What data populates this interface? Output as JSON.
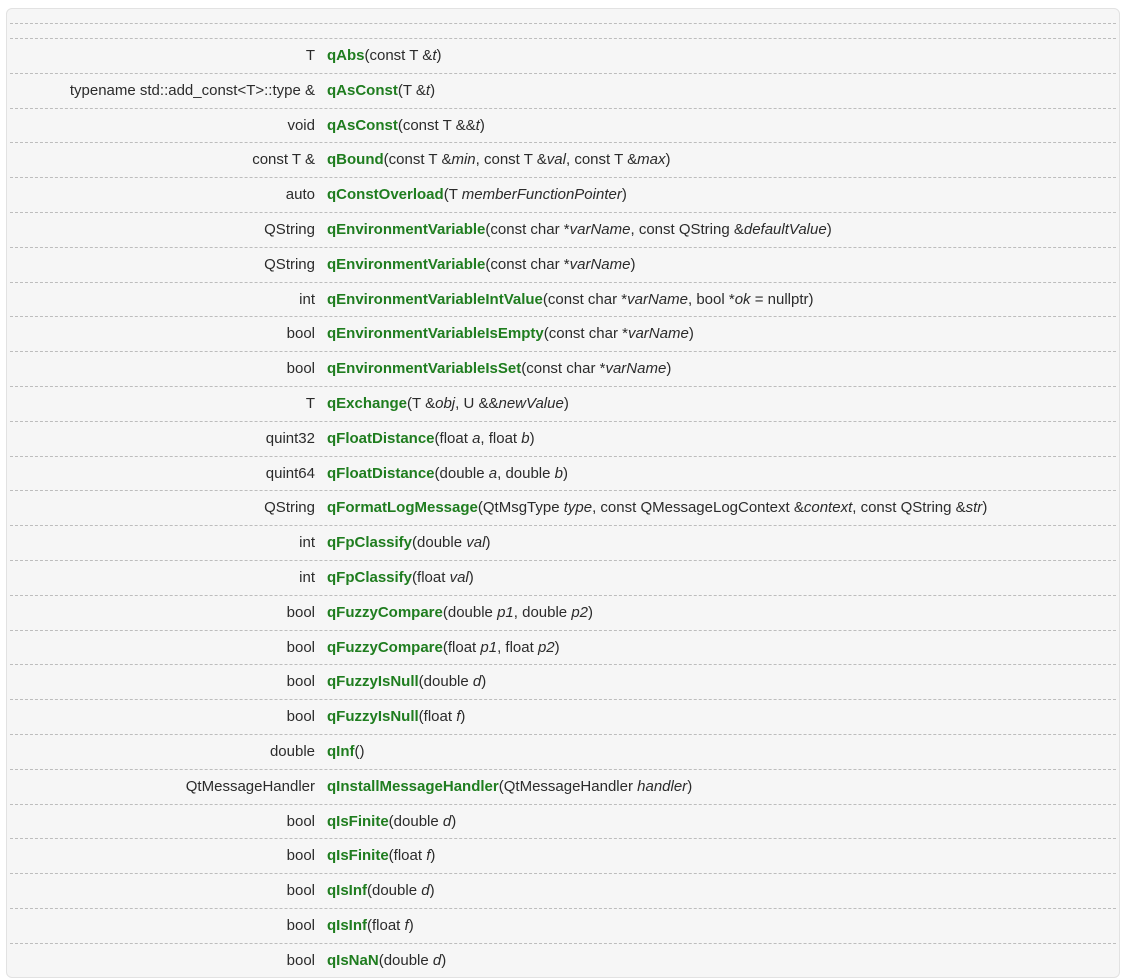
{
  "functions": [
    {
      "ret": "T",
      "name": "qAbs",
      "args": [
        [
          "const T &",
          "t"
        ]
      ]
    },
    {
      "ret": "typename std::add_const<T>::type &",
      "name": "qAsConst",
      "args": [
        [
          "T &",
          "t"
        ]
      ]
    },
    {
      "ret": "void",
      "name": "qAsConst",
      "args": [
        [
          "const T &&",
          "t"
        ]
      ]
    },
    {
      "ret": "const T &",
      "name": "qBound",
      "args": [
        [
          "const T &",
          "min"
        ],
        [
          "const T &",
          "val"
        ],
        [
          "const T &",
          "max"
        ]
      ]
    },
    {
      "ret": "auto",
      "name": "qConstOverload",
      "args": [
        [
          "T ",
          "memberFunctionPointer"
        ]
      ]
    },
    {
      "ret": "QString",
      "name": "qEnvironmentVariable",
      "args": [
        [
          "const char *",
          "varName"
        ],
        [
          "const QString &",
          "defaultValue"
        ]
      ]
    },
    {
      "ret": "QString",
      "name": "qEnvironmentVariable",
      "args": [
        [
          "const char *",
          "varName"
        ]
      ]
    },
    {
      "ret": "int",
      "name": "qEnvironmentVariableIntValue",
      "args": [
        [
          "const char *",
          "varName"
        ],
        [
          "bool *",
          "ok",
          " = nullptr"
        ]
      ]
    },
    {
      "ret": "bool",
      "name": "qEnvironmentVariableIsEmpty",
      "args": [
        [
          "const char *",
          "varName"
        ]
      ]
    },
    {
      "ret": "bool",
      "name": "qEnvironmentVariableIsSet",
      "args": [
        [
          "const char *",
          "varName"
        ]
      ]
    },
    {
      "ret": "T",
      "name": "qExchange",
      "args": [
        [
          "T &",
          "obj"
        ],
        [
          "U &&",
          "newValue"
        ]
      ]
    },
    {
      "ret": "quint32",
      "name": "qFloatDistance",
      "args": [
        [
          "float ",
          "a"
        ],
        [
          "float ",
          "b"
        ]
      ]
    },
    {
      "ret": "quint64",
      "name": "qFloatDistance",
      "args": [
        [
          "double ",
          "a"
        ],
        [
          "double ",
          "b"
        ]
      ]
    },
    {
      "ret": "QString",
      "name": "qFormatLogMessage",
      "args": [
        [
          "QtMsgType ",
          "type"
        ],
        [
          "const QMessageLogContext &",
          "context"
        ],
        [
          "const QString &",
          "str"
        ]
      ]
    },
    {
      "ret": "int",
      "name": "qFpClassify",
      "args": [
        [
          "double ",
          "val"
        ]
      ]
    },
    {
      "ret": "int",
      "name": "qFpClassify",
      "args": [
        [
          "float ",
          "val"
        ]
      ]
    },
    {
      "ret": "bool",
      "name": "qFuzzyCompare",
      "args": [
        [
          "double ",
          "p1"
        ],
        [
          "double ",
          "p2"
        ]
      ]
    },
    {
      "ret": "bool",
      "name": "qFuzzyCompare",
      "args": [
        [
          "float ",
          "p1"
        ],
        [
          "float ",
          "p2"
        ]
      ]
    },
    {
      "ret": "bool",
      "name": "qFuzzyIsNull",
      "args": [
        [
          "double ",
          "d"
        ]
      ]
    },
    {
      "ret": "bool",
      "name": "qFuzzyIsNull",
      "args": [
        [
          "float ",
          "f"
        ]
      ]
    },
    {
      "ret": "double",
      "name": "qInf",
      "args": []
    },
    {
      "ret": "QtMessageHandler",
      "name": "qInstallMessageHandler",
      "args": [
        [
          "QtMessageHandler ",
          "handler"
        ]
      ]
    },
    {
      "ret": "bool",
      "name": "qIsFinite",
      "args": [
        [
          "double ",
          "d"
        ]
      ]
    },
    {
      "ret": "bool",
      "name": "qIsFinite",
      "args": [
        [
          "float ",
          "f"
        ]
      ]
    },
    {
      "ret": "bool",
      "name": "qIsInf",
      "args": [
        [
          "double ",
          "d"
        ]
      ]
    },
    {
      "ret": "bool",
      "name": "qIsInf",
      "args": [
        [
          "float ",
          "f"
        ]
      ]
    },
    {
      "ret": "bool",
      "name": "qIsNaN",
      "args": [
        [
          "double ",
          "d"
        ]
      ]
    }
  ],
  "colors": {
    "link": "#1f7d1f",
    "text": "#2b2b2b",
    "panel": "#f6f6f6",
    "rule": "#bdbdbd"
  }
}
